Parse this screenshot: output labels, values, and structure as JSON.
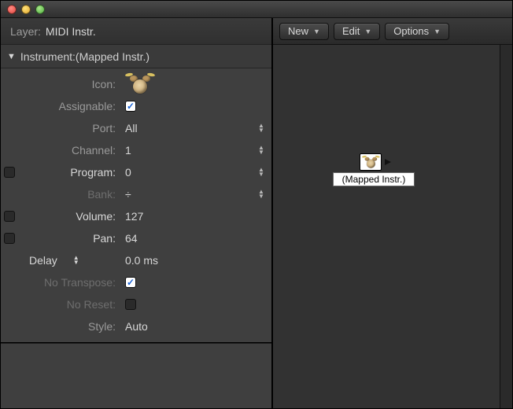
{
  "layer": {
    "label": "Layer:",
    "value": "MIDI Instr."
  },
  "section": {
    "prefix": "Instrument: ",
    "name": "(Mapped Instr.)"
  },
  "params": {
    "icon_label": "Icon:",
    "assignable": {
      "label": "Assignable:",
      "checked": true
    },
    "port": {
      "label": "Port:",
      "value": "All"
    },
    "channel": {
      "label": "Channel:",
      "value": "1"
    },
    "program": {
      "label": "Program:",
      "value": "0",
      "enabled": false
    },
    "bank": {
      "label": "Bank:",
      "value": "÷"
    },
    "volume": {
      "label": "Volume:",
      "value": "127",
      "enabled": false
    },
    "pan": {
      "label": "Pan:",
      "value": "64",
      "enabled": false
    },
    "delay": {
      "label": "Delay",
      "value": "0.0 ms"
    },
    "no_transpose": {
      "label": "No Transpose:",
      "checked": true
    },
    "no_reset": {
      "label": "No Reset:",
      "checked": false
    },
    "style": {
      "label": "Style:",
      "value": "Auto"
    }
  },
  "toolbar": {
    "new_label": "New",
    "edit_label": "Edit",
    "options_label": "Options"
  },
  "canvas": {
    "object_label": "(Mapped Instr.)"
  }
}
